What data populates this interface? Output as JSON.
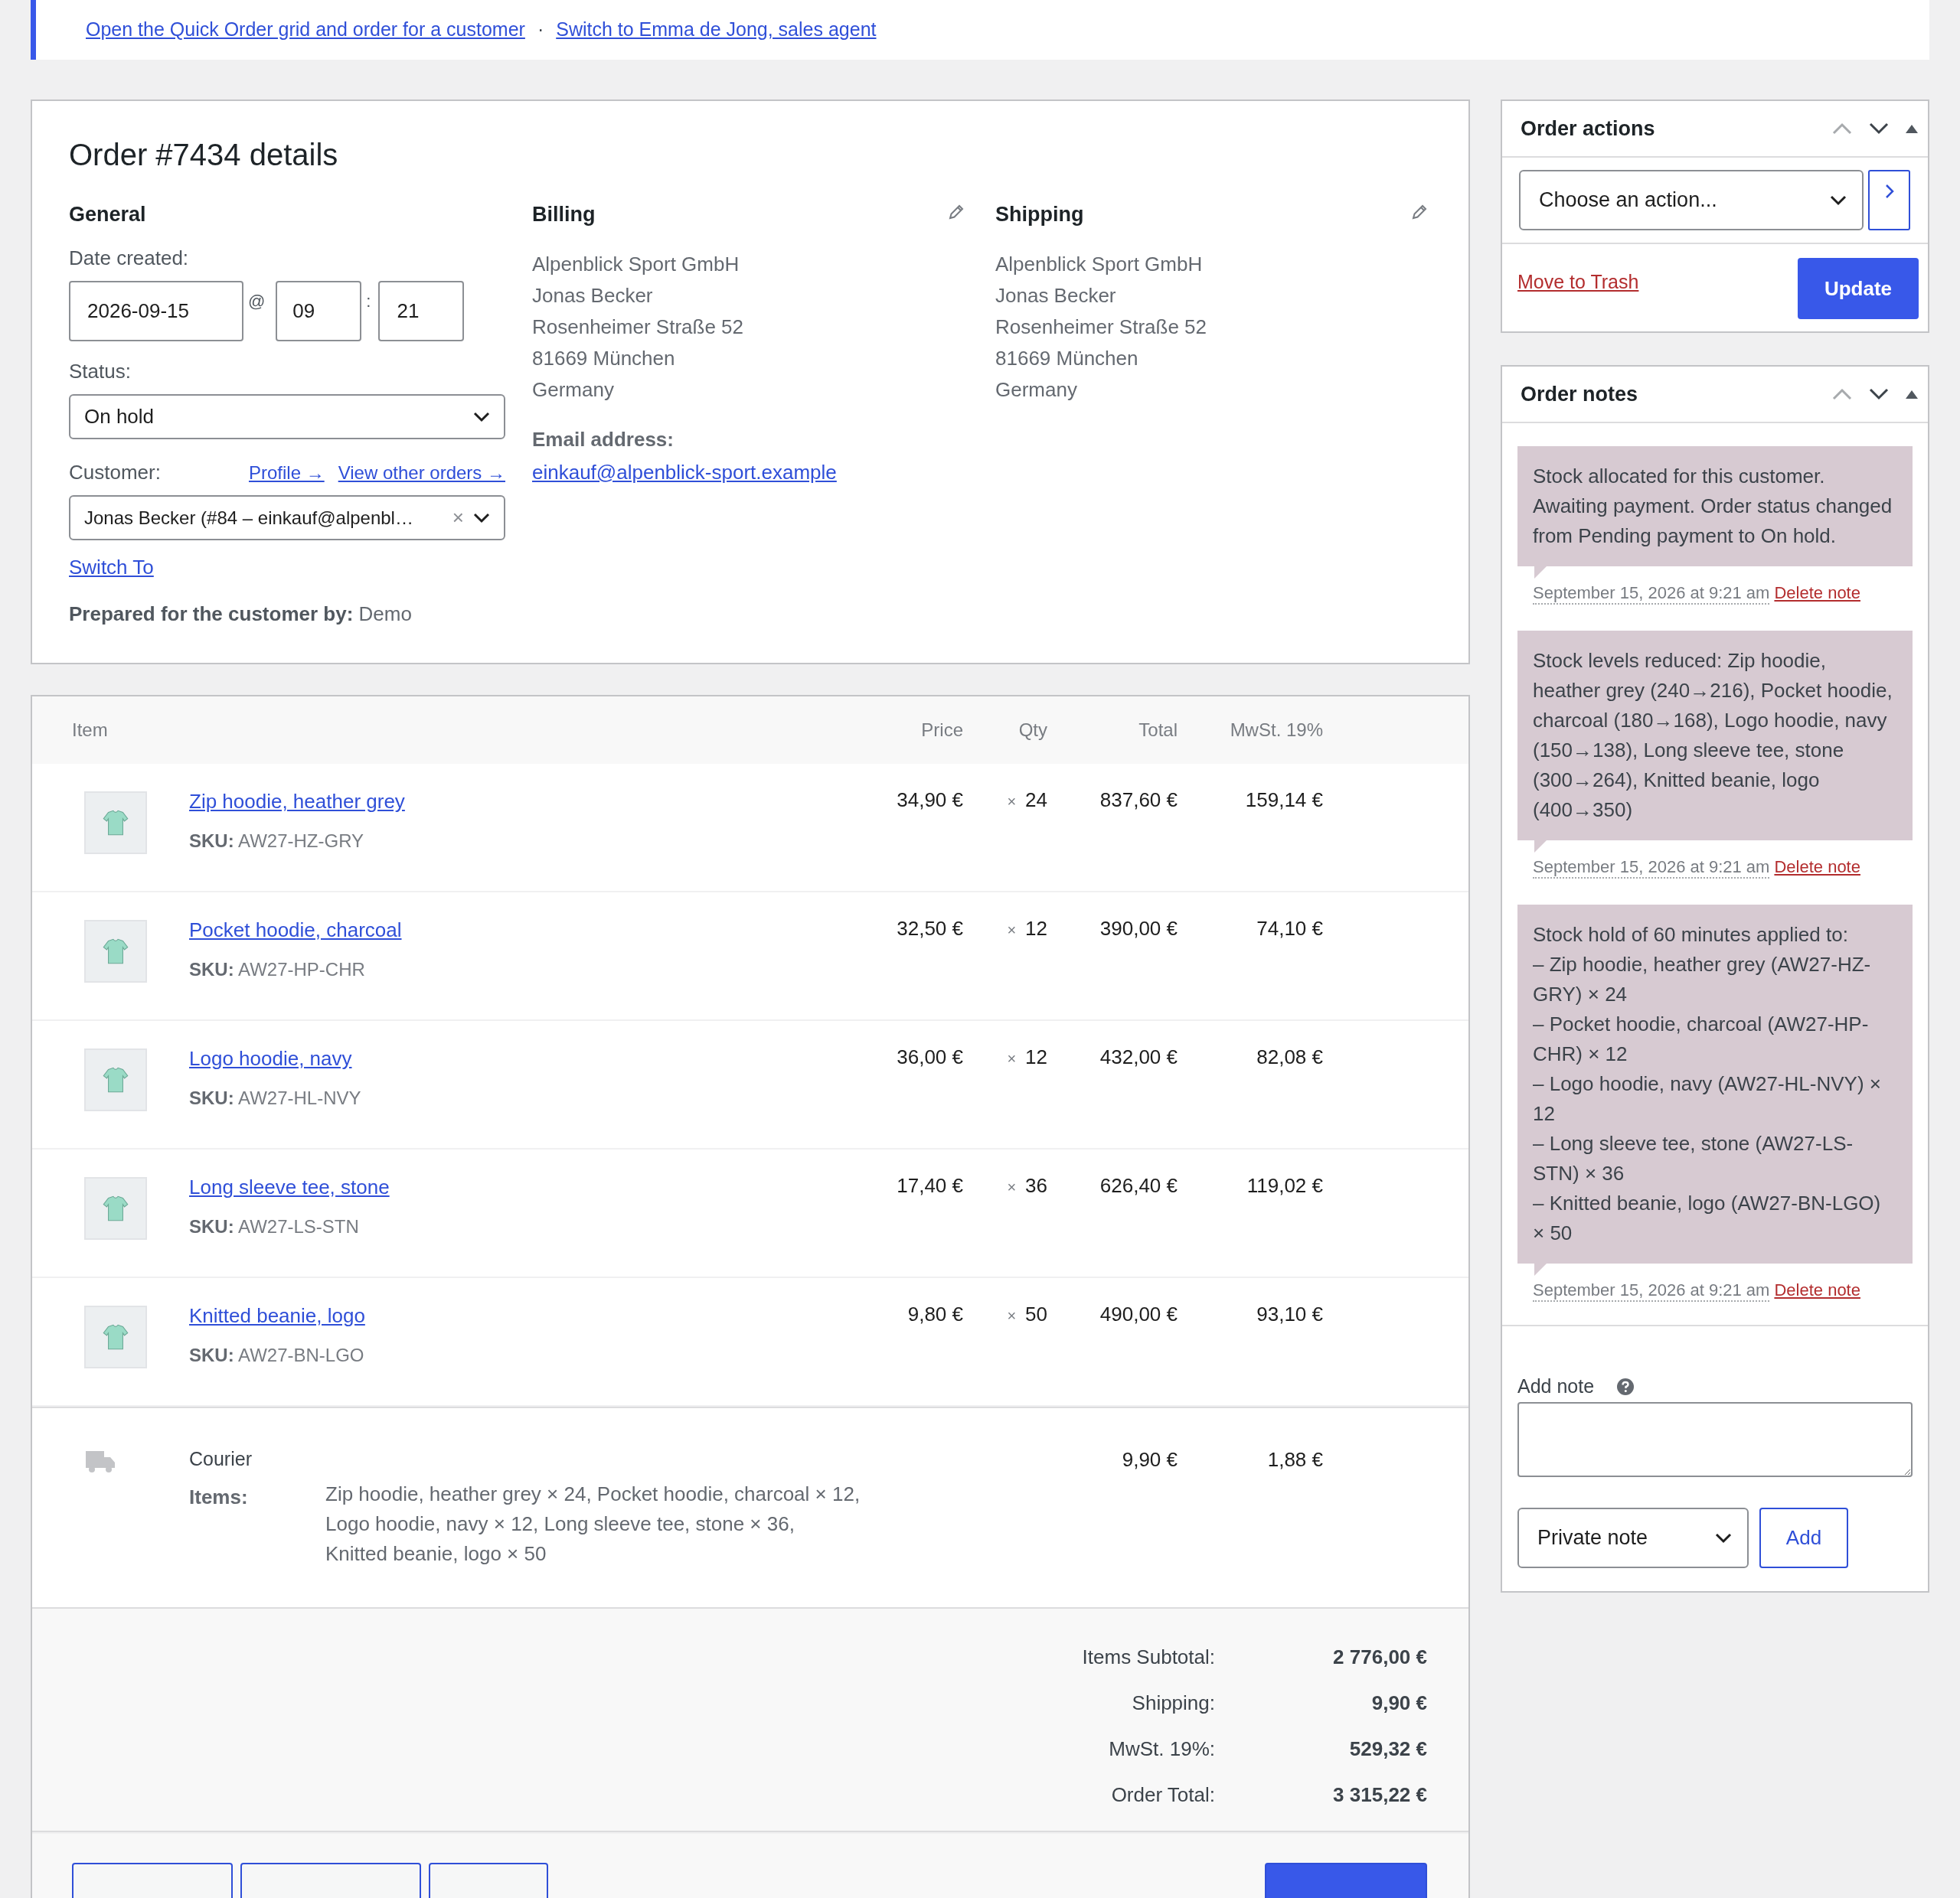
{
  "notice": {
    "links": [
      "Open the Quick Order grid and order for a customer",
      "Switch to Emma de Jong, sales agent"
    ],
    "separator": "·"
  },
  "order": {
    "title": "Order #7434 details",
    "general": {
      "heading": "General",
      "date_label": "Date created:",
      "date": "2026-09-15",
      "at": "@",
      "hour": "09",
      "colon": ":",
      "minute": "21",
      "status_label": "Status:",
      "status": "On hold",
      "customer_label": "Customer:",
      "profile_link": "Profile →",
      "orders_link": "View other orders →",
      "customer": "Jonas Becker (#84 – einkauf@alpenbl…",
      "clear": "×",
      "switch_link": "Switch To",
      "prepared_label": "Prepared for the customer by:",
      "prepared_by": "Demo"
    },
    "billing": {
      "heading": "Billing",
      "address": [
        "Alpenblick Sport GmbH",
        "Jonas Becker",
        "Rosenheimer Straße 52",
        "81669 München",
        "Germany"
      ],
      "email_label": "Email address:",
      "email": "einkauf@alpenblick-sport.example"
    },
    "shipping": {
      "heading": "Shipping",
      "address": [
        "Alpenblick Sport GmbH",
        "Jonas Becker",
        "Rosenheimer Straße 52",
        "81669 München",
        "Germany"
      ]
    }
  },
  "items": {
    "columns": [
      "Item",
      "Price",
      "Qty",
      "Total",
      "MwSt. 19%"
    ],
    "rows": [
      {
        "name": "Zip hoodie, heather grey",
        "sku_label": "SKU:",
        "sku": "AW27-HZ-GRY",
        "price": "34,90 €",
        "qty_sign": "×",
        "qty": "24",
        "total": "837,60 €",
        "tax": "159,14 €"
      },
      {
        "name": "Pocket hoodie, charcoal",
        "sku_label": "SKU:",
        "sku": "AW27-HP-CHR",
        "price": "32,50 €",
        "qty_sign": "×",
        "qty": "12",
        "total": "390,00 €",
        "tax": "74,10 €"
      },
      {
        "name": "Logo hoodie, navy",
        "sku_label": "SKU:",
        "sku": "AW27-HL-NVY",
        "price": "36,00 €",
        "qty_sign": "×",
        "qty": "12",
        "total": "432,00 €",
        "tax": "82,08 €"
      },
      {
        "name": "Long sleeve tee, stone",
        "sku_label": "SKU:",
        "sku": "AW27-LS-STN",
        "price": "17,40 €",
        "qty_sign": "×",
        "qty": "36",
        "total": "626,40 €",
        "tax": "119,02 €"
      },
      {
        "name": "Knitted beanie, logo",
        "sku_label": "SKU:",
        "sku": "AW27-BN-LGO",
        "price": "9,80 €",
        "qty_sign": "×",
        "qty": "50",
        "total": "490,00 €",
        "tax": "93,10 €"
      }
    ],
    "shipping_line": {
      "method": "Courier",
      "items_label": "Items:",
      "items": "Zip hoodie, heather grey × 24, Pocket hoodie, charcoal × 12, Logo hoodie, navy × 12, Long sleeve tee, stone × 36, Knitted beanie, logo × 50",
      "total": "9,90 €",
      "tax": "1,88 €"
    },
    "totals": [
      {
        "label": "Items Subtotal:",
        "value": "2 776,00 €"
      },
      {
        "label": "Shipping:",
        "value": "9,90 €"
      },
      {
        "label": "MwSt. 19%:",
        "value": "529,32 €"
      },
      {
        "label": "Order Total:",
        "value": "3 315,22 €"
      }
    ]
  },
  "order_actions": {
    "title": "Order actions",
    "action": "Choose an action...",
    "trash": "Move to Trash",
    "update": "Update"
  },
  "order_notes": {
    "title": "Order notes",
    "notes": [
      {
        "text": "Stock allocated for this customer. Awaiting payment. Order status changed from Pending payment to On hold.",
        "date": "September 15, 2026 at 9:21 am",
        "delete": "Delete note"
      },
      {
        "text": "Stock levels reduced: Zip hoodie, heather grey (240→216), Pocket hoodie, charcoal (180→168), Logo hoodie, navy (150→138), Long sleeve tee, stone (300→264), Knitted beanie, logo (400→350)",
        "date": "September 15, 2026 at 9:21 am",
        "delete": "Delete note"
      },
      {
        "text": "Stock hold of 60 minutes applied to:\n– Zip hoodie, heather grey (AW27-HZ-GRY) × 24\n– Pocket hoodie, charcoal (AW27-HP-CHR) × 12\n– Logo hoodie, navy (AW27-HL-NVY) × 12\n– Long sleeve tee, stone (AW27-LS-STN) × 36\n– Knitted beanie, logo (AW27-BN-LGO) × 50",
        "date": "September 15, 2026 at 9:21 am",
        "delete": "Delete note"
      }
    ],
    "add_label": "Add note",
    "note_type": "Private note",
    "add": "Add"
  }
}
